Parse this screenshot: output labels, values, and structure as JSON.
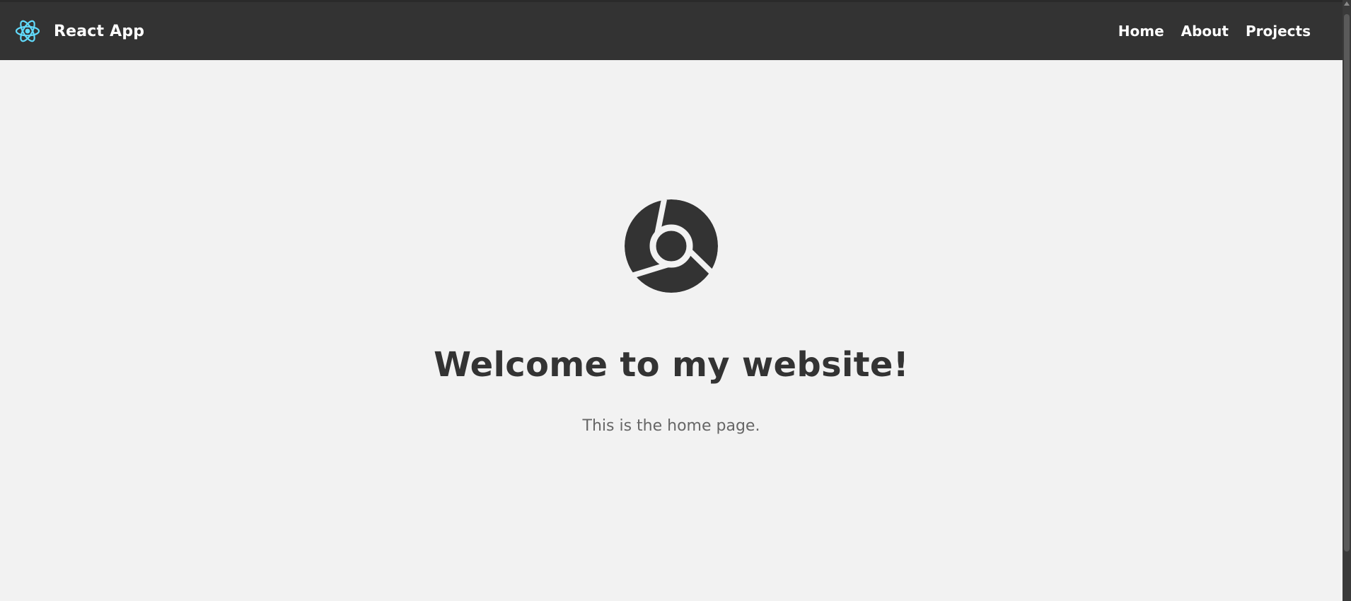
{
  "header": {
    "brand_icon": "react-atom-icon",
    "brand_title": "React App",
    "nav": [
      {
        "label": "Home"
      },
      {
        "label": "About"
      },
      {
        "label": "Projects"
      }
    ]
  },
  "hero": {
    "icon": "chrome-logo-icon",
    "title": "Welcome to my website!",
    "subtitle": "This is the home page."
  },
  "colors": {
    "navbar_bg": "#333333",
    "page_bg": "#f2f2f2",
    "react_accent": "#61dafb",
    "text_dark": "#333333",
    "text_muted": "#666666"
  }
}
